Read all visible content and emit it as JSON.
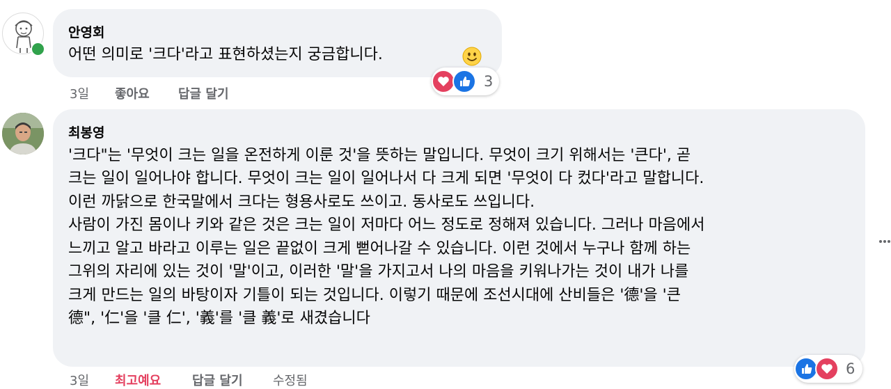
{
  "comments": [
    {
      "author": "안영회",
      "lines": [
        "어떤 의미로 '크다'라고 표현하셨는지 궁금합니다."
      ],
      "emoji": "🙂",
      "reactions": {
        "count": "3",
        "icons": [
          "love-icon",
          "like-icon"
        ]
      },
      "time": "3일",
      "like_label": "좋아요",
      "reply_label": "답글 달기"
    },
    {
      "author": "최봉영",
      "lines": [
        "'크다\"는 '무엇이 크는 일을 온전하게 이룬 것'을 뜻하는 말입니다. 무엇이 크기 위해서는 '큰다', 곧",
        "크는 일이 일어나야 합니다. 무엇이 크는 일이 일어나서 다 크게 되면 '무엇이 다 컸다'라고 말합니다.",
        "이런 까닭으로 한국말에서 크다는 형용사로도 쓰이고. 동사로도 쓰입니다.",
        "사람이 가진 몸이나 키와 같은 것은 크는 일이 저마다 어느 정도로 정해져 있습니다. 그러나 마음에서",
        "느끼고 알고 바라고 이루는 일은 끝없이 크게 뻗어나갈 수 있습니다. 이런 것에서 누구나 함께 하는",
        "그위의 자리에 있는 것이 '말'이고, 이러한 '말'을 가지고서 나의 마음을 키워나가는 것이 내가 나를",
        "크게 만드는 일의 바탕이자 기틀이 되는 것입니다. 이렇기 때문에 조선시대에 산비들은 '德'을 '큰",
        "德\", '仁'을 '클 仁', '義'를 '클 義'로 새겼습니다"
      ],
      "reactions": {
        "count": "6",
        "icons": [
          "like-icon",
          "love-icon"
        ]
      },
      "time": "3일",
      "like_label": "최고예요",
      "reply_label": "답글 달기",
      "edited_label": "수정됨"
    }
  ],
  "colors": {
    "bubble": "#f0f2f5",
    "meta": "#65676b",
    "love_reaction": "#e4405f",
    "like_reaction": "#1b74e4",
    "online": "#31a24c"
  }
}
